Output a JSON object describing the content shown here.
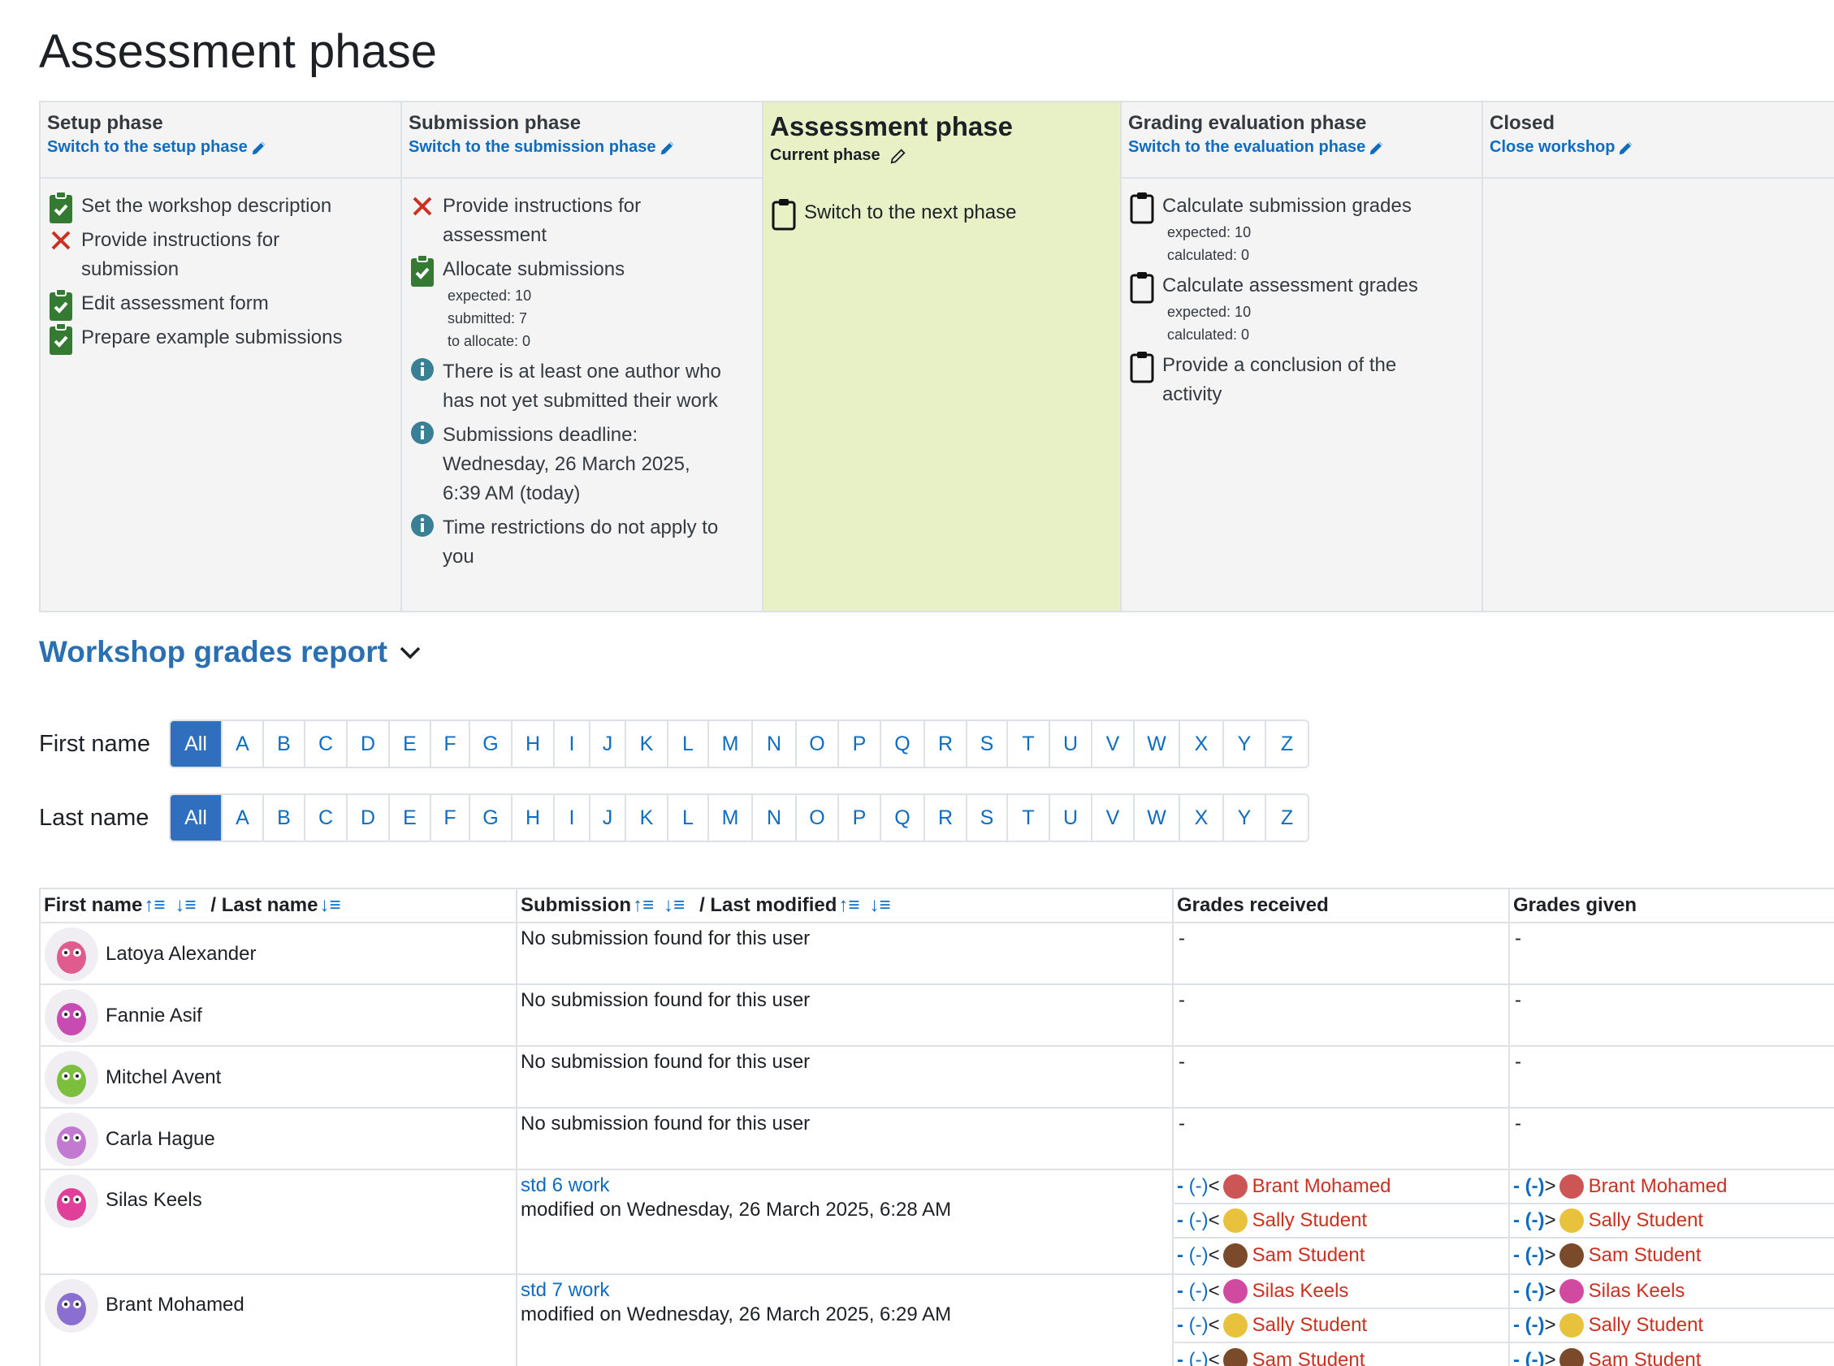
{
  "page": {
    "title": "Assessment phase"
  },
  "phases": [
    {
      "title": "Setup phase",
      "switch": "Switch to the setup phase",
      "tasks": [
        {
          "icon": "check-clipboard-icon",
          "text": "Set the workshop description"
        },
        {
          "icon": "cross-icon",
          "text": "Provide instructions for submission"
        },
        {
          "icon": "check-clipboard-icon",
          "text": "Edit assessment form"
        },
        {
          "icon": "check-clipboard-icon",
          "text": "Prepare example submissions"
        }
      ]
    },
    {
      "title": "Submission phase",
      "switch": "Switch to the submission phase",
      "tasks": [
        {
          "icon": "cross-icon",
          "text": "Provide instructions for assessment"
        },
        {
          "icon": "check-clipboard-icon",
          "text": "Allocate submissions",
          "details": [
            "expected: 10",
            "submitted: 7",
            "to allocate: 0"
          ]
        },
        {
          "icon": "info-icon",
          "text": "There is at least one author who has not yet submitted their work"
        },
        {
          "icon": "info-icon",
          "text": "Submissions deadline: Wednesday, 26 March 2025, 6:39 AM (today)"
        },
        {
          "icon": "info-icon",
          "text": "Time restrictions do not apply to you"
        }
      ]
    },
    {
      "title": "Assessment phase",
      "switch": "Current phase",
      "tasks": [
        {
          "icon": "clipboard-icon",
          "text": "Switch to the next phase"
        }
      ]
    },
    {
      "title": "Grading evaluation phase",
      "switch": "Switch to the evaluation phase",
      "tasks": [
        {
          "icon": "clipboard-icon",
          "text": "Calculate submission grades",
          "details": [
            "expected: 10",
            "calculated: 0"
          ]
        },
        {
          "icon": "clipboard-icon",
          "text": "Calculate assessment grades",
          "details": [
            "expected: 10",
            "calculated: 0"
          ]
        },
        {
          "icon": "clipboard-icon",
          "text": "Provide a conclusion of the activity"
        }
      ]
    },
    {
      "title": "Closed",
      "switch": "Close workshop",
      "tasks": []
    }
  ],
  "report": {
    "heading": "Workshop grades report"
  },
  "filters": {
    "first_label": "First name",
    "last_label": "Last name",
    "all": "All",
    "letters": [
      "A",
      "B",
      "C",
      "D",
      "E",
      "F",
      "G",
      "H",
      "I",
      "J",
      "K",
      "L",
      "M",
      "N",
      "O",
      "P",
      "Q",
      "R",
      "S",
      "T",
      "U",
      "V",
      "W",
      "X",
      "Y",
      "Z"
    ]
  },
  "table": {
    "headers": {
      "first_name": "First name",
      "last_name": "/ Last name",
      "submission": "Submission",
      "last_modified": "/ Last modified",
      "grades_received": "Grades received",
      "grades_given": "Grades given"
    },
    "rows": [
      {
        "name": "Latoya Alexander",
        "submission": "No submission found for this user",
        "received": "-",
        "given": "-"
      },
      {
        "name": "Fannie Asif",
        "submission": "No submission found for this user",
        "received": "-",
        "given": "-"
      },
      {
        "name": "Mitchel Avent",
        "submission": "No submission found for this user",
        "received": "-",
        "given": "-"
      },
      {
        "name": "Carla Hague",
        "submission": "No submission found for this user",
        "received": "-",
        "given": "-"
      },
      {
        "name": "Silas Keels",
        "submission_link": "std 6 work",
        "modified": "modified on Wednesday, 26 March 2025, 6:28 AM",
        "received_list": [
          "Brant Mohamed",
          "Sally Student",
          "Sam Student"
        ],
        "given_list": [
          "Brant Mohamed",
          "Sally Student",
          "Sam Student"
        ]
      },
      {
        "name": "Brant Mohamed",
        "submission_link": "std 7 work",
        "modified": "modified on Wednesday, 26 March 2025, 6:29 AM",
        "received_list": [
          "Silas Keels",
          "Sally Student",
          "Sam Student"
        ],
        "given_list": [
          "Silas Keels",
          "Sally Student",
          "Sam Student"
        ]
      }
    ],
    "grade_prefix": "-",
    "grade_value": "(-)",
    "received_arrow": "<",
    "given_arrow": ">"
  },
  "colors": {
    "accent": "#0f6cbf",
    "current_phase_bg": "#e8f1c6",
    "phase_bg": "#f4f4f5",
    "success": "#357a32",
    "danger": "#ca3120",
    "info": "#398095"
  }
}
